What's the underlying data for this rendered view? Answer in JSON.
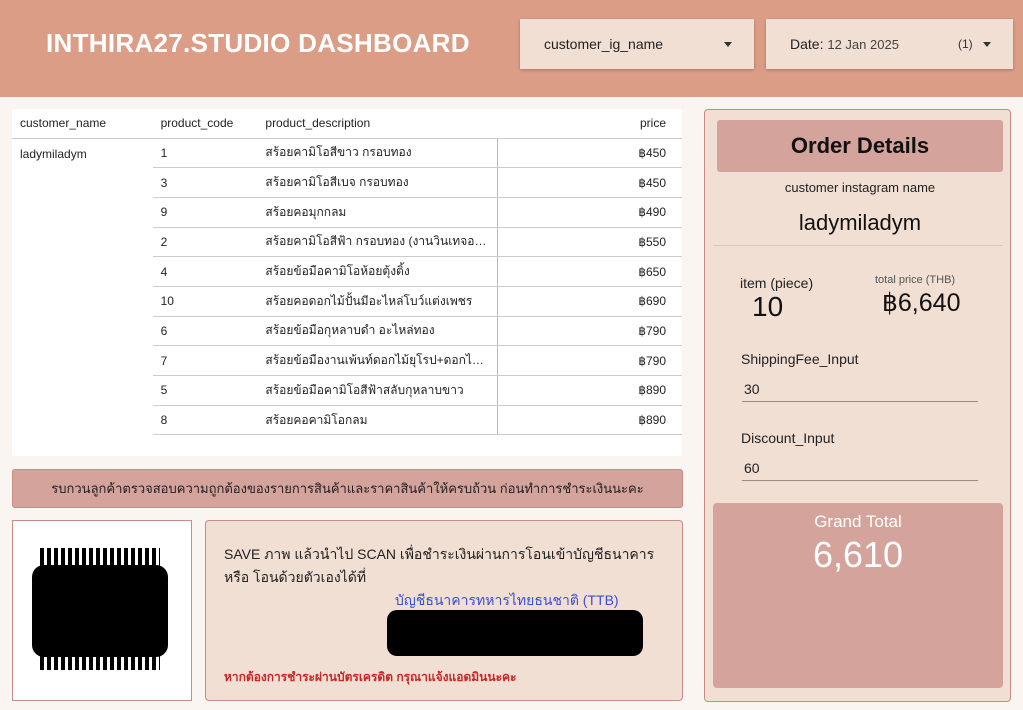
{
  "header": {
    "title": "INTHIRA27.STUDIO DASHBOARD",
    "customer_filter": "customer_ig_name",
    "date_label": "Date:",
    "date_value": "12 Jan 2025",
    "date_count": "(1)"
  },
  "table": {
    "columns": [
      "customer_name",
      "product_code",
      "product_description",
      "price"
    ],
    "customer": "ladymiladym",
    "rows": [
      {
        "code": "1",
        "desc": "สร้อยคามิโอสีขาว กรอบทอง",
        "price": "฿450"
      },
      {
        "code": "3",
        "desc": "สร้อยคามิโอสีเบจ กรอบทอง",
        "price": "฿450"
      },
      {
        "code": "9",
        "desc": "สร้อยคอมุกกลม",
        "price": "฿490"
      },
      {
        "code": "2",
        "desc": "สร้อยคามิโอสีฟ้า กรอบทอง (งานวินเทจออ...",
        "price": "฿550"
      },
      {
        "code": "4",
        "desc": "สร้อยข้อมือคามิโอห้อยตุ้งติ้ง",
        "price": "฿650"
      },
      {
        "code": "10",
        "desc": "สร้อยคอดอกไม้ปั้นมีอะไหล่โบว์แต่งเพชร",
        "price": "฿690"
      },
      {
        "code": "6",
        "desc": "สร้อยข้อมือกุหลาบดำ อะไหล่ทอง",
        "price": "฿790"
      },
      {
        "code": "7",
        "desc": "สร้อยข้อมืองานเพ้นท์ดอกไม้ยุโรป+ดอกไม้...",
        "price": "฿790"
      },
      {
        "code": "5",
        "desc": "สร้อยข้อมือคามิโอสีฟ้าสลับกุหลาบขาว",
        "price": "฿890"
      },
      {
        "code": "8",
        "desc": "สร้อยคอคามิโอกลม",
        "price": "฿890"
      }
    ]
  },
  "banner": "รบกวนลูกค้าตรวจสอบความถูกต้องของรายการสินค้าและราคาสินค้าให้ครบถ้วน ก่อนทำการชำระเงินนะคะ",
  "payment": {
    "instruction": "SAVE ภาพ แล้วนำไป SCAN เพื่อชำระเงินผ่านการโอนเข้าบัญชีธนาคาร หรือ โอนด้วยตัวเองได้ที่",
    "bank": "บัญชีธนาคารทหารไทยธนชาติ (TTB)",
    "warning": "หากต้องการชำระผ่านบัตรเครดิต กรุณาแจ้งแอดมินนะคะ"
  },
  "order": {
    "title": "Order Details",
    "customer_label": "customer instagram name",
    "customer_name": "ladymiladym",
    "item_label": "item (piece)",
    "item_value": "10",
    "total_label": "total price (THB)",
    "total_value": "฿6,640",
    "shipping_label": "ShippingFee_Input",
    "shipping_value": "30",
    "discount_label": "Discount_Input",
    "discount_value": "60",
    "grand_label": "Grand Total",
    "grand_value": "6,610"
  }
}
